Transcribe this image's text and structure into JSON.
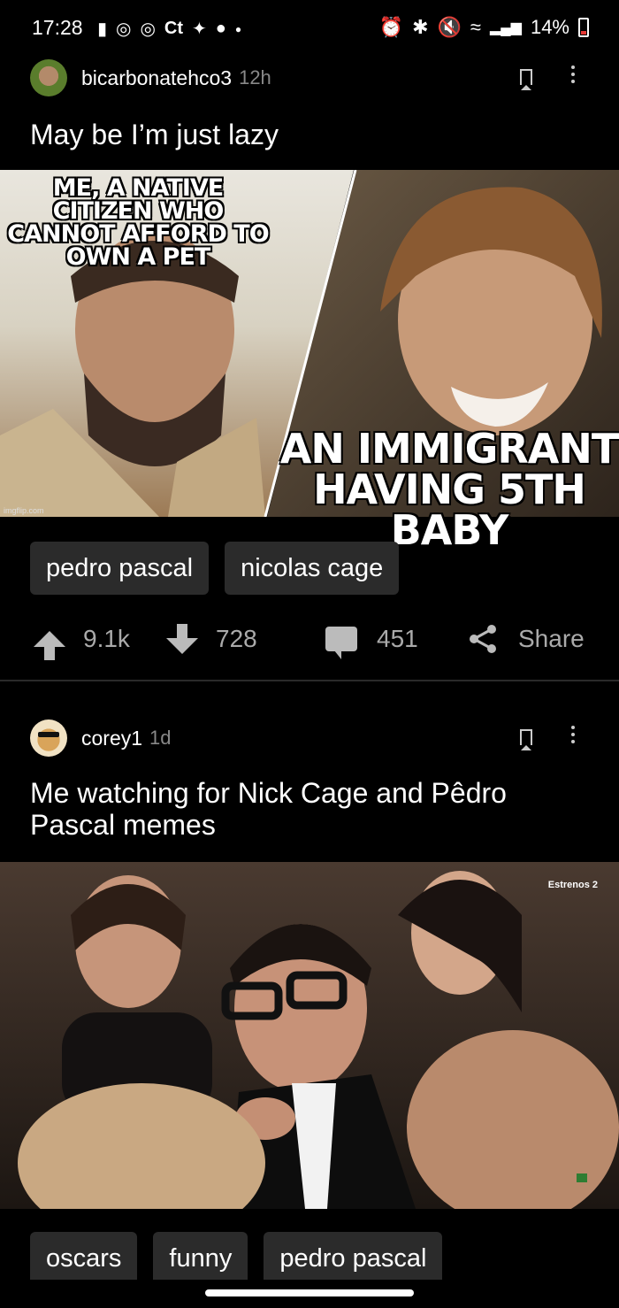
{
  "status_bar": {
    "time": "17:28",
    "left_icons": [
      "lock-icon",
      "instagram-icon",
      "instagram-icon",
      "ct-text",
      "twitter-icon",
      "reddit-icon",
      "dot-icon"
    ],
    "ct_label": "Ct",
    "battery": "14%",
    "right_icons": [
      "alarm-icon",
      "bluetooth-icon",
      "mute-icon",
      "wifi-icon",
      "signal-icon"
    ]
  },
  "posts": [
    {
      "username": "bicarbonatehco3",
      "age": "12h",
      "title": "May be I’m just lazy",
      "meme_top_caption": "ME, A NATIVE CITIZEN WHO CANNOT AFFORD TO OWN A PET",
      "meme_bottom_caption": "AN IMMIGRANT HAVING 5TH BABY",
      "watermark": "imgflip.com",
      "tags": [
        "pedro pascal",
        "nicolas cage"
      ],
      "upvotes": "9.1k",
      "downvotes": "728",
      "comments": "451",
      "share_label": "Share"
    },
    {
      "username": "corey1",
      "age": "1d",
      "title": "Me watching for Nick Cage and Pêdro Pascal memes",
      "image_overlay": "Estrenos 2",
      "tags": [
        "oscars",
        "funny",
        "pedro pascal"
      ]
    }
  ],
  "colors": {
    "background": "#000000",
    "tag_bg": "#2b2b2b",
    "muted_text": "#888888",
    "battery_low": "#e53935"
  }
}
